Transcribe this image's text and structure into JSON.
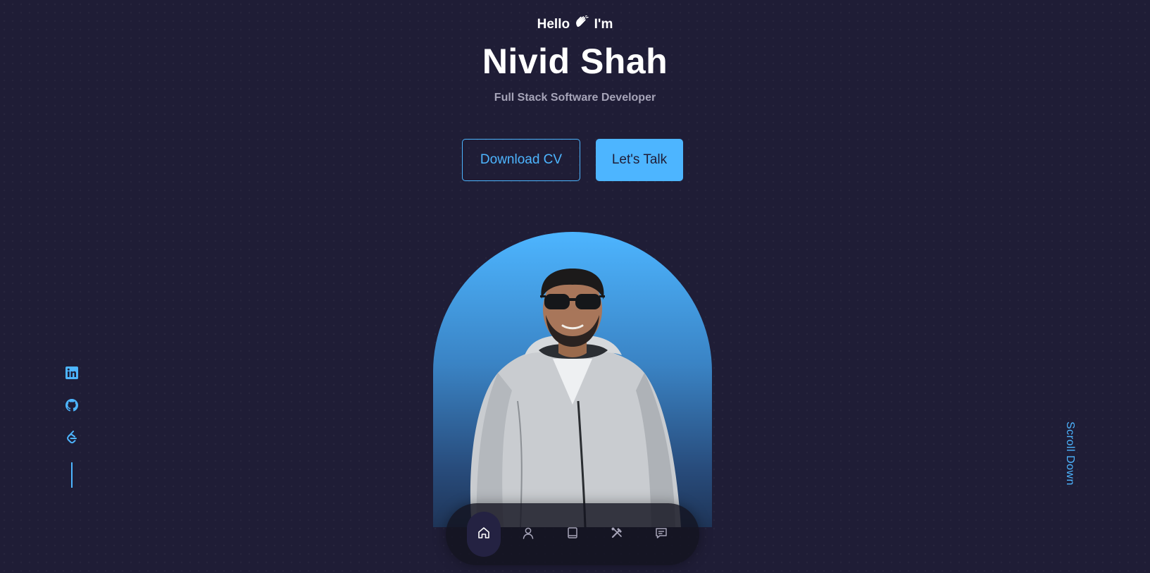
{
  "hero": {
    "greeting_before": "Hello",
    "greeting_after": "I'm",
    "name": "Nivid Shah",
    "role": "Full Stack Software Developer"
  },
  "actions": {
    "download_cv": "Download CV",
    "lets_talk": "Let's Talk"
  },
  "socials": [
    {
      "icon": "linkedin-icon"
    },
    {
      "icon": "github-icon"
    },
    {
      "icon": "leetcode-icon"
    }
  ],
  "scroll": {
    "label": "Scroll Down"
  },
  "nav": {
    "items": [
      {
        "icon": "home-icon",
        "active": true
      },
      {
        "icon": "user-icon",
        "active": false
      },
      {
        "icon": "book-icon",
        "active": false
      },
      {
        "icon": "tools-icon",
        "active": false
      },
      {
        "icon": "message-icon",
        "active": false
      }
    ]
  },
  "colors": {
    "background": "#1f1d36",
    "accent": "#4db5ff",
    "muted_text": "#a6a4b8",
    "nav_background": "#15151f"
  }
}
